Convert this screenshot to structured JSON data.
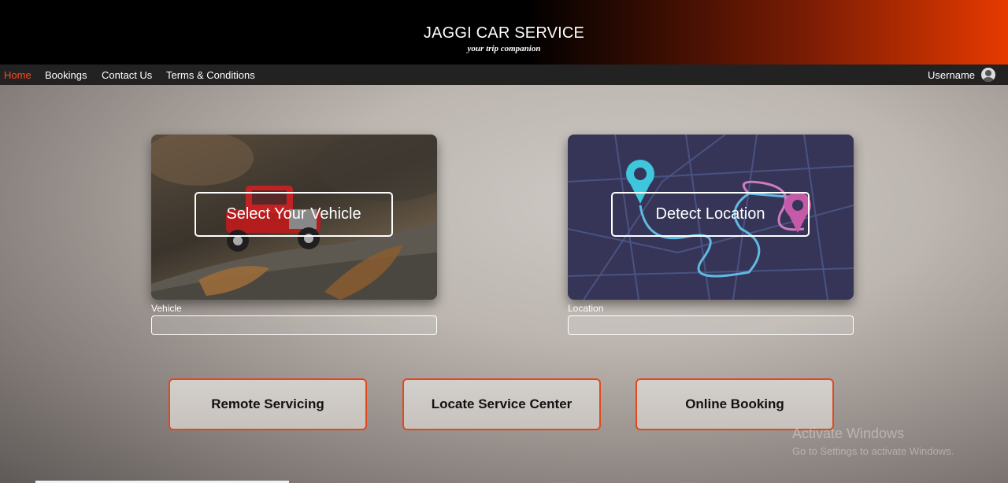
{
  "header": {
    "title": "JAGGI CAR SERVICE",
    "tagline": "your trip companion"
  },
  "nav": {
    "items": [
      {
        "label": "Home",
        "active": true
      },
      {
        "label": "Bookings"
      },
      {
        "label": "Contact Us"
      },
      {
        "label": "Terms & Conditions"
      }
    ],
    "username": "Username",
    "avatar_icon": "user-circle-icon"
  },
  "cards": {
    "vehicle": {
      "button_label": "Select Your Vehicle",
      "field_label": "Vehicle",
      "value": ""
    },
    "location": {
      "button_label": "Detect Location",
      "field_label": "Location",
      "value": ""
    }
  },
  "actions": {
    "remote": "Remote Servicing",
    "locate": "Locate Service Center",
    "booking": "Online Booking"
  },
  "watermark": {
    "title": "Activate Windows",
    "subtitle": "Go to Settings to activate Windows."
  },
  "colors": {
    "accent": "#ff4a1a",
    "button_border": "#e0491e",
    "nav_bg": "#222222",
    "map_bg": "#363558"
  }
}
